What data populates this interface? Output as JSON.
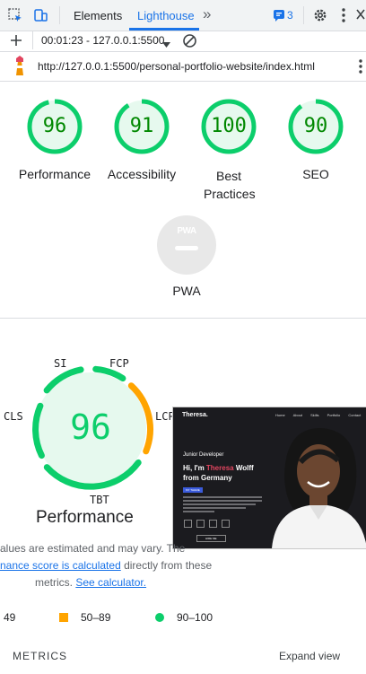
{
  "devtools": {
    "tabs": [
      "Elements",
      "Lighthouse"
    ],
    "more_tabs": "»",
    "issues_count": "3"
  },
  "toolbar": {
    "report_label": "00:01:23 - 127.0.0.1:5500"
  },
  "url_bar": {
    "url": "http://127.0.0.1:5500/personal-portfolio-website/index.html"
  },
  "scores": [
    {
      "value": 96,
      "label": "Performance"
    },
    {
      "value": 91,
      "label": "Accessibility"
    },
    {
      "value": 100,
      "label": "Best Practices"
    },
    {
      "value": 90,
      "label": "SEO"
    }
  ],
  "pwa": {
    "badge": "PWA",
    "label": "PWA"
  },
  "performance": {
    "score": 96,
    "title": "Performance",
    "metric_labels": {
      "si": "SI",
      "fcp": "FCP",
      "lcp": "LCP",
      "tbt": "TBT",
      "cls": "CLS"
    }
  },
  "note": {
    "line1": "alues are estimated and may vary. The",
    "link1": "nance score is calculated",
    "line2_rest": " directly from these",
    "line3": "metrics. ",
    "link2": "See calculator."
  },
  "legend": {
    "fail": "49",
    "average": "50–89",
    "pass": "90–100"
  },
  "metrics_header": {
    "title": "METRICS",
    "expand": "Expand view"
  },
  "screenshot": {
    "brand": "Theresa.",
    "nav": [
      "Home",
      "About",
      "Skills",
      "Portfolio",
      "Contact"
    ],
    "subtitle": "Junior Developer",
    "headline_pre": "Hi, I'm ",
    "headline_name": "Theresa",
    "headline_post": " Wolff",
    "headline_line2": "from Germany",
    "badge": "MY THEME",
    "button": "HIRE ME"
  },
  "colors": {
    "pass_green": "#0cce6b",
    "pass_text": "#008800",
    "average_orange": "#ffa400",
    "link_blue": "#1a73e8",
    "accent_pink": "#e2455f"
  }
}
